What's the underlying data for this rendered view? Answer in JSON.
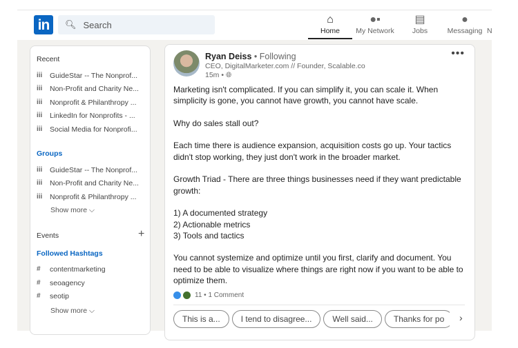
{
  "header": {
    "logo": "in",
    "search_placeholder": "Search",
    "nav": [
      {
        "label": "Home",
        "icon": "home-icon",
        "glyph": "⌂"
      },
      {
        "label": "My Network",
        "icon": "network-icon",
        "glyph": "👥"
      },
      {
        "label": "Jobs",
        "icon": "briefcase-icon",
        "glyph": "💼"
      },
      {
        "label": "Messaging",
        "icon": "messaging-icon",
        "glyph": "💬"
      },
      {
        "label": "N",
        "icon": "notifications-icon",
        "glyph": ""
      }
    ]
  },
  "sidebar": {
    "recent_title": "Recent",
    "recent": [
      "GuideStar -- The Nonprof...",
      "Non-Profit and Charity Ne...",
      "Nonprofit & Philanthropy ...",
      "LinkedIn for Nonprofits - ...",
      "Social Media for Nonprofi..."
    ],
    "groups_title": "Groups",
    "groups": [
      "GuideStar -- The Nonprof...",
      "Non-Profit and Charity Ne...",
      "Nonprofit & Philanthropy ..."
    ],
    "show_more": "Show more",
    "events_title": "Events",
    "hashtags_title": "Followed Hashtags",
    "hashtags": [
      "contentmarketing",
      "seoagency",
      "seotip"
    ]
  },
  "post": {
    "author": "Ryan Deiss",
    "following": "• Following",
    "headline": "CEO, DigitalMarketer.com // Founder, Scalable.co",
    "time": "15m •",
    "paragraphs": [
      "Marketing isn't complicated. If you can simplify it, you can scale it. When simplicity is gone, you cannot have growth, you cannot have scale.",
      "Why do sales stall out?",
      "Each time there is audience expansion, acquisition costs go up. Your tactics didn't stop working, they just don't work in the broader market.",
      "Growth Triad - There are three things businesses need if they want predictable growth:",
      "1) A documented strategy\n2) Actionable metrics\n3) Tools and tactics",
      "You cannot systemize and optimize until you first, clarify and document. You need to be able to visualize where things are right now if you want to be able to optimize them."
    ],
    "reactions": "11 • 1 Comment",
    "suggestions": [
      "This is a...",
      "I tend to disagree...",
      "Well said...",
      "Thanks for po"
    ]
  },
  "colors": {
    "brand": "#0a66c2",
    "background": "#f3f2ef"
  }
}
